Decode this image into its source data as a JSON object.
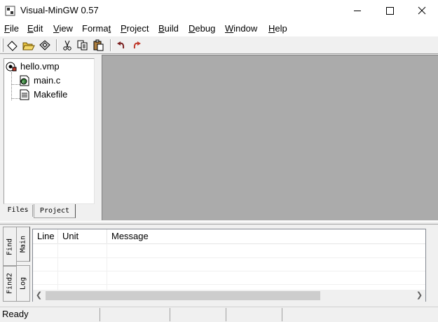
{
  "window": {
    "title": "Visual-MinGW 0.57"
  },
  "menu": [
    {
      "label_pre": "",
      "accel": "F",
      "label_post": "ile"
    },
    {
      "label_pre": "",
      "accel": "E",
      "label_post": "dit"
    },
    {
      "label_pre": "",
      "accel": "V",
      "label_post": "iew"
    },
    {
      "label_pre": "Forma",
      "accel": "t",
      "label_post": ""
    },
    {
      "label_pre": "",
      "accel": "P",
      "label_post": "roject"
    },
    {
      "label_pre": "",
      "accel": "B",
      "label_post": "uild"
    },
    {
      "label_pre": "",
      "accel": "D",
      "label_post": "ebug"
    },
    {
      "label_pre": "",
      "accel": "W",
      "label_post": "indow"
    },
    {
      "label_pre": "",
      "accel": "H",
      "label_post": "elp"
    }
  ],
  "toolbar": {
    "icons": [
      "new-file-icon",
      "open-folder-icon",
      "save-icon",
      "cut-icon",
      "copy-icon",
      "paste-icon",
      "undo-icon",
      "redo-icon"
    ]
  },
  "tree": {
    "root": "hello.vmp",
    "children": [
      "main.c",
      "Makefile"
    ]
  },
  "left_tabs": {
    "files": "Files",
    "project": "Project"
  },
  "bottom_tabs": {
    "main": "Main",
    "find": "Find",
    "log": "Log",
    "find2": "Find2"
  },
  "messages": {
    "columns": [
      "Line",
      "Unit",
      "Message"
    ]
  },
  "status": {
    "text": "Ready"
  },
  "colors": {
    "mdi_background": "#ababab",
    "redo_arrow": "#c0392b",
    "undo_arrow": "#7a2020"
  }
}
